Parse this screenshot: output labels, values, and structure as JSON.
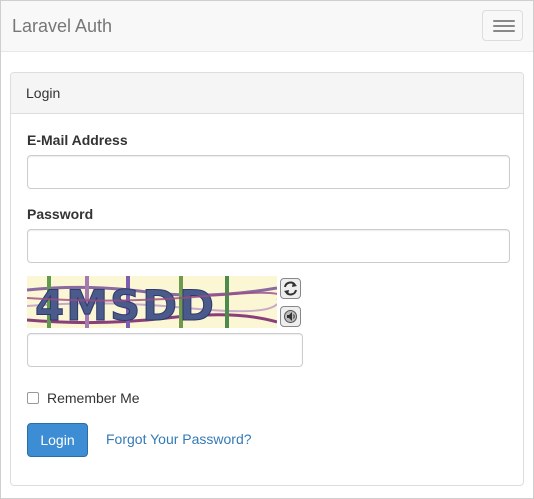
{
  "navbar": {
    "brand": "Laravel Auth",
    "toggle_icon": "hamburger-icon"
  },
  "panel": {
    "heading": "Login"
  },
  "form": {
    "email_label": "E-Mail Address",
    "email_value": "",
    "password_label": "Password",
    "password_value": "",
    "captcha_text": "4MSDD",
    "captcha_input_value": "",
    "refresh_icon": "refresh-icon",
    "audio_icon": "speaker-icon",
    "remember_label": "Remember Me",
    "remember_checked": false,
    "login_button": "Login",
    "forgot_link": "Forgot Your Password?"
  },
  "colors": {
    "primary": "#3c8dd3",
    "link": "#337ab7",
    "navbar_bg": "#f8f8f8",
    "panel_heading_bg": "#f5f5f5"
  }
}
